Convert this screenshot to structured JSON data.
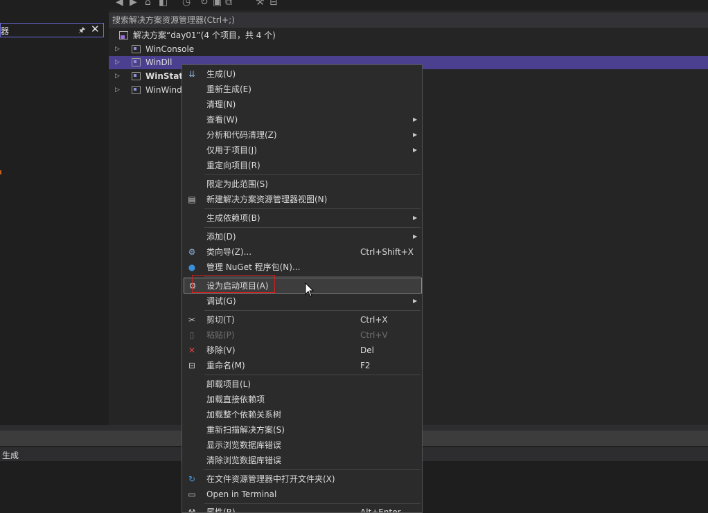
{
  "left_panel": {
    "title": "器",
    "pin_icon": "pin-icon",
    "close_icon": "close-icon"
  },
  "explorer": {
    "search_placeholder": "搜索解决方案资源管理器(Ctrl+;)",
    "solution_label": "解决方案“day01”(4 个项目，共 4 个)",
    "projects": [
      {
        "label": "WinConsole",
        "bold": false,
        "selected": false
      },
      {
        "label": "WinDll",
        "bold": false,
        "selected": true
      },
      {
        "label": "WinStati",
        "bold": true,
        "selected": false
      },
      {
        "label": "WinWind",
        "bold": false,
        "selected": false
      }
    ]
  },
  "bottom_panel": {
    "title": "生成"
  },
  "context_menu": {
    "items": [
      {
        "label": "生成(U)",
        "icon": "build-icon",
        "shortcut": "",
        "submenu": false,
        "disabled": false
      },
      {
        "label": "重新生成(E)",
        "icon": "",
        "shortcut": "",
        "submenu": false,
        "disabled": false
      },
      {
        "label": "清理(N)",
        "icon": "",
        "shortcut": "",
        "submenu": false,
        "disabled": false
      },
      {
        "label": "查看(W)",
        "icon": "",
        "shortcut": "",
        "submenu": true,
        "disabled": false
      },
      {
        "label": "分析和代码清理(Z)",
        "icon": "",
        "shortcut": "",
        "submenu": true,
        "disabled": false
      },
      {
        "label": "仅用于项目(J)",
        "icon": "",
        "shortcut": "",
        "submenu": true,
        "disabled": false
      },
      {
        "label": "重定向项目(R)",
        "icon": "",
        "shortcut": "",
        "submenu": false,
        "disabled": false
      },
      {
        "label": "限定为此范围(S)",
        "icon": "",
        "shortcut": "",
        "submenu": false,
        "disabled": false
      },
      {
        "label": "新建解决方案资源管理器视图(N)",
        "icon": "new-view-icon",
        "shortcut": "",
        "submenu": false,
        "disabled": false
      },
      {
        "label": "生成依赖项(B)",
        "icon": "",
        "shortcut": "",
        "submenu": true,
        "disabled": false
      },
      {
        "label": "添加(D)",
        "icon": "",
        "shortcut": "",
        "submenu": true,
        "disabled": false
      },
      {
        "label": "类向导(Z)...",
        "icon": "class-wizard-icon",
        "shortcut": "Ctrl+Shift+X",
        "submenu": false,
        "disabled": false
      },
      {
        "label": "管理 NuGet 程序包(N)...",
        "icon": "nuget-icon",
        "shortcut": "",
        "submenu": false,
        "disabled": false
      },
      {
        "label": "设为启动项目(A)",
        "icon": "gear-icon",
        "shortcut": "",
        "submenu": false,
        "disabled": false
      },
      {
        "label": "调试(G)",
        "icon": "",
        "shortcut": "",
        "submenu": true,
        "disabled": false
      },
      {
        "label": "剪切(T)",
        "icon": "cut-icon",
        "shortcut": "Ctrl+X",
        "submenu": false,
        "disabled": false
      },
      {
        "label": "粘贴(P)",
        "icon": "paste-icon",
        "shortcut": "Ctrl+V",
        "submenu": false,
        "disabled": true
      },
      {
        "label": "移除(V)",
        "icon": "remove-icon",
        "shortcut": "Del",
        "submenu": false,
        "disabled": false
      },
      {
        "label": "重命名(M)",
        "icon": "rename-icon",
        "shortcut": "F2",
        "submenu": false,
        "disabled": false
      },
      {
        "label": "卸载项目(L)",
        "icon": "",
        "shortcut": "",
        "submenu": false,
        "disabled": false
      },
      {
        "label": "加载直接依赖项",
        "icon": "",
        "shortcut": "",
        "submenu": false,
        "disabled": false
      },
      {
        "label": "加载整个依赖关系树",
        "icon": "",
        "shortcut": "",
        "submenu": false,
        "disabled": false
      },
      {
        "label": "重新扫描解决方案(S)",
        "icon": "",
        "shortcut": "",
        "submenu": false,
        "disabled": false
      },
      {
        "label": "显示浏览数据库错误",
        "icon": "",
        "shortcut": "",
        "submenu": false,
        "disabled": false
      },
      {
        "label": "清除浏览数据库错误",
        "icon": "",
        "shortcut": "",
        "submenu": false,
        "disabled": false
      },
      {
        "label": "在文件资源管理器中打开文件夹(X)",
        "icon": "open-folder-icon",
        "shortcut": "",
        "submenu": false,
        "disabled": false
      },
      {
        "label": "Open in Terminal",
        "icon": "terminal-icon",
        "shortcut": "",
        "submenu": false,
        "disabled": false
      },
      {
        "label": "属性(R)",
        "icon": "wrench-icon",
        "shortcut": "Alt+Enter",
        "submenu": false,
        "disabled": false
      }
    ],
    "highlighted_index": 13
  },
  "colors": {
    "selection": "#4b3f8f",
    "accent_border": "#6c6ce0",
    "annotation_red": "#d02020"
  }
}
